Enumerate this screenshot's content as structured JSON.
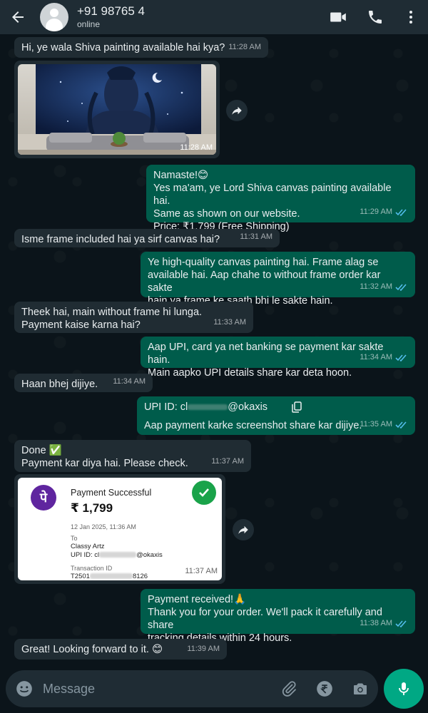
{
  "header": {
    "contact_name": "+91 98765 4",
    "status": "online"
  },
  "messages": [
    {
      "id": "m1",
      "dir": "in",
      "text": "Hi, ye wala Shiva painting available hai kya?",
      "time": "11:28 AM"
    },
    {
      "id": "m2",
      "dir": "in",
      "type": "image",
      "time": "11:28 AM"
    },
    {
      "id": "m3",
      "dir": "out",
      "text": "Namaste!😊\nYes ma'am, ye Lord Shiva canvas painting available hai.\nSame as shown on our website.\nPrice: ₹1,799 (Free Shipping)",
      "time": "11:29 AM"
    },
    {
      "id": "m4",
      "dir": "in",
      "text": "Isme frame included hai ya sirf canvas hai?",
      "time": "11:31 AM"
    },
    {
      "id": "m5",
      "dir": "out",
      "text": "Ye high-quality canvas painting hai. Frame alag se\navailable hai. Aap chahe to without frame order kar sakte\nhain ya frame ke saath bhi le sakte hain.",
      "time": "11:32 AM"
    },
    {
      "id": "m6",
      "dir": "in",
      "text": "Theek hai, main without frame hi lunga.\nPayment kaise karna hai?",
      "time": "11:33 AM"
    },
    {
      "id": "m7",
      "dir": "out",
      "text": "Aap UPI, card ya net banking se payment kar sakte hain.\nMain aapko UPI details share kar deta hoon.",
      "time": "11:34 AM"
    },
    {
      "id": "m8",
      "dir": "in",
      "text": "Haan bhej dijiye.",
      "time": "11:34 AM"
    },
    {
      "id": "m9",
      "dir": "out",
      "upi_prefix": "UPI ID: cl",
      "upi_suffix": "@okaxis",
      "text": "Aap payment karke screenshot share kar dijiye.",
      "time": "11:35 AM"
    },
    {
      "id": "m10",
      "dir": "in",
      "text": "Done ✅\nPayment kar diya hai. Please check.",
      "time": "11:37 AM"
    },
    {
      "id": "m11",
      "dir": "in",
      "type": "receipt",
      "time": "11:37 AM"
    },
    {
      "id": "m12",
      "dir": "out",
      "text": "Payment received!🙏\nThank you for your order. We'll pack it carefully and share\ntracking details within 24 hours.",
      "time": "11:38 AM"
    },
    {
      "id": "m13",
      "dir": "in",
      "text": "Great! Looking forward to it. 😊",
      "time": "11:39 AM"
    }
  ],
  "receipt": {
    "logo": "पे",
    "title": "Payment Successful",
    "amount": "₹ 1,799",
    "date": "12 Jan 2025, 11:36 AM",
    "to_label": "To",
    "to_name": "Classy Artz",
    "upi_prefix": "UPI ID: cl",
    "upi_suffix": "@okaxis",
    "txn_label": "Transaction ID",
    "txn_prefix": "T2501",
    "txn_suffix": "8126"
  },
  "composer": {
    "placeholder": "Message"
  },
  "colors": {
    "incoming": "#202c33",
    "outgoing": "#005c4b",
    "accent": "#00a884",
    "read_tick": "#53bdeb"
  },
  "icons": [
    "back-arrow-icon",
    "video-call-icon",
    "phone-icon",
    "more-options-icon",
    "forward-icon",
    "copy-icon",
    "read-ticks-icon",
    "emoji-icon",
    "attach-icon",
    "rupee-icon",
    "camera-icon",
    "mic-icon"
  ]
}
